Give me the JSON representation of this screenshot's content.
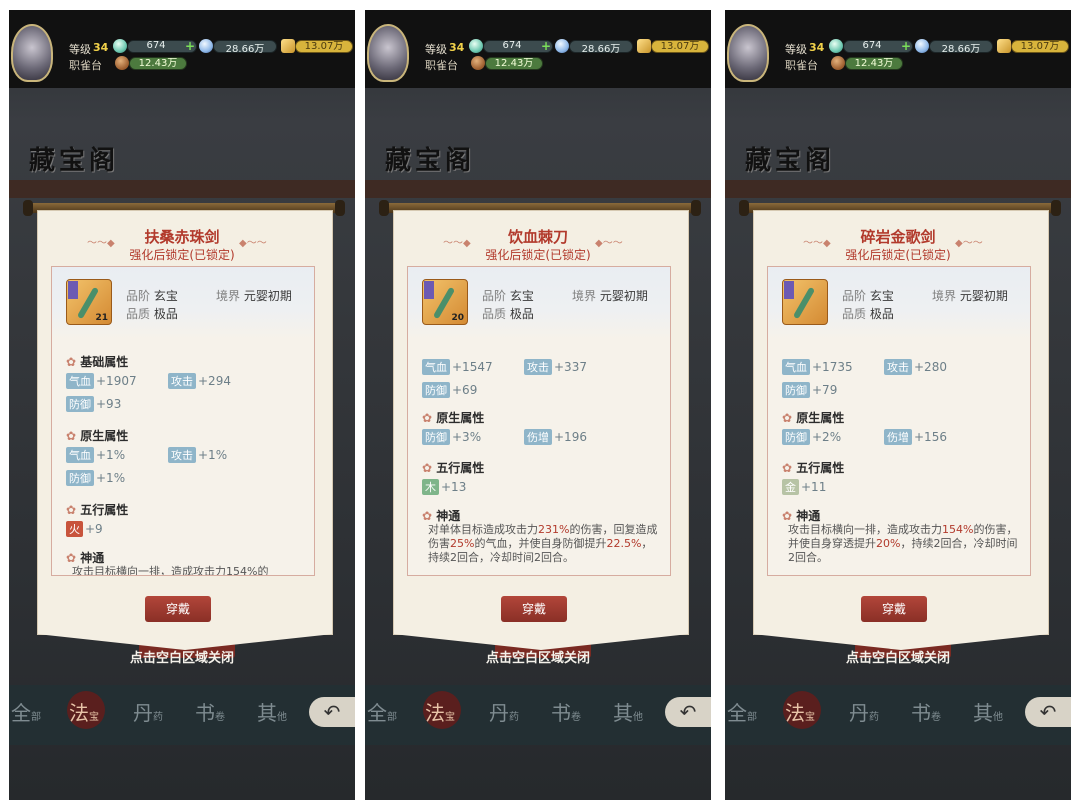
{
  "hud": {
    "level_label": "等级",
    "level": "34",
    "location": "职雀台",
    "jade": "674",
    "crystal": "28.66万",
    "gold": "13.07万",
    "wood": "12.43万"
  },
  "shop": {
    "title": "藏宝阁",
    "close_hint": "点击空白区域关闭",
    "nav": [
      "全",
      "部",
      "法",
      "宝",
      "丹",
      "药",
      "书",
      "卷",
      "其",
      "他"
    ],
    "back_icon": "undo-arrow-icon"
  },
  "labels": {
    "grade": "品阶",
    "quality": "品质",
    "realm": "境界",
    "base": "基础属性",
    "native": "原生属性",
    "wuxing": "五行属性",
    "skill": "神通",
    "wear": "穿戴",
    "lock": "强化后锁定(已锁定)"
  },
  "items": [
    {
      "name": "扶桑赤珠剑",
      "enh": "21",
      "grade": "玄宝",
      "quality": "极品",
      "realm": "元婴初期",
      "base": [
        [
          "气血",
          "+1907"
        ],
        [
          "攻击",
          "+294"
        ],
        [
          "防御",
          "+93"
        ]
      ],
      "native": [
        [
          "气血",
          "+1%"
        ],
        [
          "攻击",
          "+1%"
        ],
        [
          "防御",
          "+1%"
        ]
      ],
      "wuxing": [
        "火",
        "+9"
      ],
      "skill": "攻击目标横向一排，造成攻击力154%的"
    },
    {
      "name": "饮血棘刀",
      "enh": "20",
      "grade": "玄宝",
      "quality": "极品",
      "realm": "元婴初期",
      "base": [
        [
          "气血",
          "+1547"
        ],
        [
          "攻击",
          "+337"
        ],
        [
          "防御",
          "+69"
        ]
      ],
      "native": [
        [
          "防御",
          "+3%"
        ],
        [
          "伤增",
          "+196"
        ]
      ],
      "wuxing": [
        "木",
        "+13"
      ],
      "skill": [
        "对单体目标造成攻击力",
        "231%",
        "的伤害，回复造成伤害",
        "25%",
        "的气血，并使自身防御提升",
        "22.5%",
        "，持续2回合，冷却时间2回合。"
      ]
    },
    {
      "name": "碎岩金歌剑",
      "enh": "",
      "grade": "玄宝",
      "quality": "极品",
      "realm": "元婴初期",
      "base": [
        [
          "气血",
          "+1735"
        ],
        [
          "攻击",
          "+280"
        ],
        [
          "防御",
          "+79"
        ]
      ],
      "native": [
        [
          "防御",
          "+2%"
        ],
        [
          "伤增",
          "+156"
        ]
      ],
      "wuxing": [
        "金",
        "+11"
      ],
      "skill": [
        "攻击目标横向一排，造成攻击力",
        "154%",
        "的伤害，并使自身穿透提升",
        "20%",
        "，持续2回合，冷却时间2回合。"
      ]
    }
  ]
}
